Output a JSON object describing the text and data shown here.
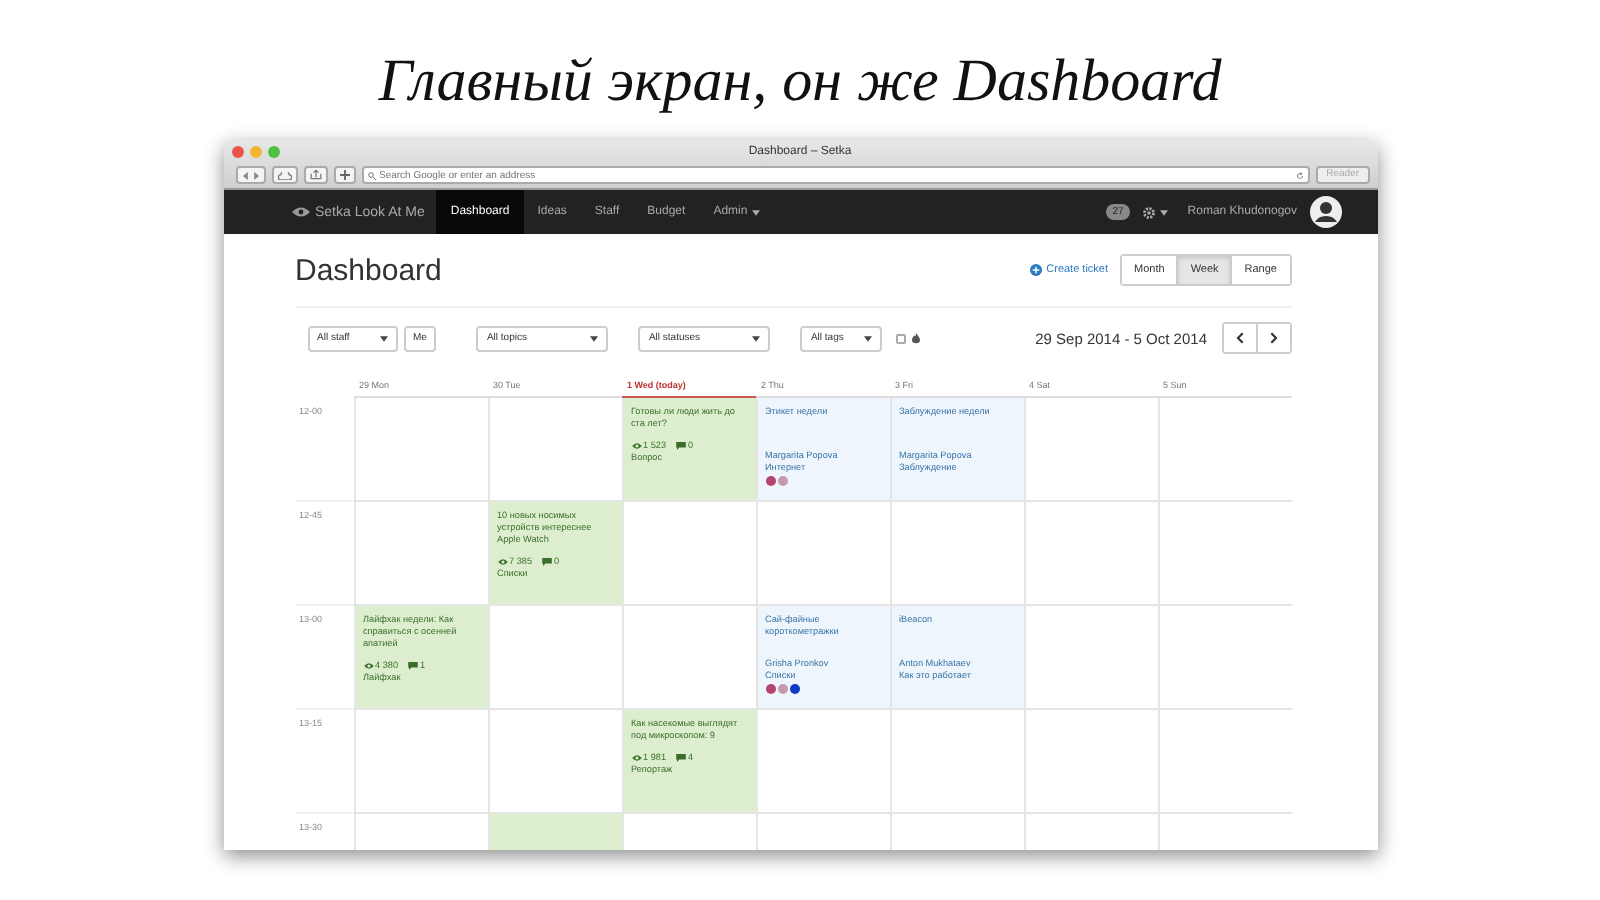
{
  "slide": {
    "title": "Главный экран, он же Dashboard"
  },
  "window": {
    "title": "Dashboard – Setka",
    "address_placeholder": "Search Google or enter an address",
    "reader": "Reader"
  },
  "nav": {
    "brand": "Setka Look At Me",
    "items": [
      {
        "label": "Dashboard",
        "selected": true,
        "dropdown": false
      },
      {
        "label": "Ideas",
        "selected": false,
        "dropdown": false
      },
      {
        "label": "Staff",
        "selected": false,
        "dropdown": false
      },
      {
        "label": "Budget",
        "selected": false,
        "dropdown": false
      },
      {
        "label": "Admin",
        "selected": false,
        "dropdown": true
      }
    ],
    "badge": "27",
    "user": "Roman Khudonogov"
  },
  "header": {
    "title": "Dashboard",
    "create": "Create ticket",
    "views": [
      {
        "label": "Month",
        "selected": false
      },
      {
        "label": "Week",
        "selected": true
      },
      {
        "label": "Range",
        "selected": false
      }
    ]
  },
  "filters": {
    "staff": "All staff",
    "me": "Me",
    "topics": "All topics",
    "statuses": "All statuses",
    "tags": "All tags",
    "hot_checked": false,
    "range": "29 Sep 2014 - 5 Oct 2014"
  },
  "calendar": {
    "days": [
      {
        "label": "29 Mon",
        "today": false
      },
      {
        "label": "30 Tue",
        "today": false
      },
      {
        "label": "1 Wed (today)",
        "today": true
      },
      {
        "label": "2 Thu",
        "today": false
      },
      {
        "label": "3 Fri",
        "today": false
      },
      {
        "label": "4 Sat",
        "today": false
      },
      {
        "label": "5 Sun",
        "today": false
      }
    ],
    "rows": [
      {
        "time": "12-00",
        "cells": [
          null,
          null,
          {
            "kind": "article",
            "title": "Готовы ли люди жить до ста лет?",
            "views": "1 523",
            "comments": "0",
            "category": "Вопрос"
          },
          {
            "kind": "ticket",
            "title": "Этикет недели",
            "author": "Margarita Popova",
            "category": "Интернет",
            "dots": [
              {
                "color": "#b5456e"
              },
              {
                "color": "#c799ad"
              }
            ]
          },
          {
            "kind": "ticket",
            "title": "Заблуждение недели",
            "author": "Margarita Popova",
            "category": "Заблуждение"
          },
          null,
          null
        ]
      },
      {
        "time": "12-45",
        "cells": [
          null,
          {
            "kind": "article",
            "title": "10 новых носимых устройств интереснее Apple Watch",
            "views": "7 385",
            "comments": "0",
            "category": "Списки"
          },
          null,
          null,
          null,
          null,
          null
        ]
      },
      {
        "time": "13-00",
        "cells": [
          {
            "kind": "article",
            "title": "Лайфхак недели: Как справиться с осенней апатией",
            "views": "4 380",
            "comments": "1",
            "category": "Лайфхак"
          },
          null,
          null,
          {
            "kind": "ticket",
            "title": "Сай-файные короткометражки",
            "author": "Grisha Pronkov",
            "category": "Списки",
            "dots": [
              {
                "color": "#b5456e"
              },
              {
                "color": "#c799ad"
              },
              {
                "color": "#1038c8"
              }
            ]
          },
          {
            "kind": "ticket",
            "title": "iBeacon",
            "author": "Anton Mukhataev",
            "category": "Как это работает"
          },
          null,
          null
        ]
      },
      {
        "time": "13-15",
        "cells": [
          null,
          null,
          {
            "kind": "article",
            "title": "Как насекомые выглядят под микроскопом: 9",
            "views": "1 981",
            "comments": "4",
            "category": "Репортаж"
          },
          null,
          null,
          null,
          null
        ]
      },
      {
        "time": "13-30",
        "cells": [
          null,
          {
            "kind": "article"
          },
          null,
          null,
          null,
          null,
          null
        ]
      }
    ]
  }
}
